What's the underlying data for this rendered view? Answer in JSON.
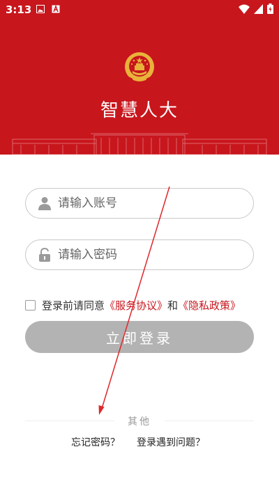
{
  "status_bar": {
    "time": "3:13",
    "left_icons": [
      "image-icon",
      "a-icon"
    ],
    "right_icons": [
      "wifi-icon",
      "signal-icon",
      "battery-icon"
    ]
  },
  "header": {
    "emblem": "national-emblem",
    "title": "智慧人大",
    "bg_color": "#c8161d"
  },
  "form": {
    "account_placeholder": "请输入账号",
    "password_placeholder": "请输入密码",
    "agree_prefix": "登录前请同意",
    "service_link": "《服务协议》",
    "and": "和",
    "privacy_link": "《隐私政策》",
    "login_button": "立即登录"
  },
  "other": {
    "label": "其他",
    "forgot_password": "忘记密码？",
    "login_problem": "登录遇到问题？"
  },
  "colors": {
    "accent": "#c8161d",
    "button_disabled": "#b3b3b3"
  }
}
